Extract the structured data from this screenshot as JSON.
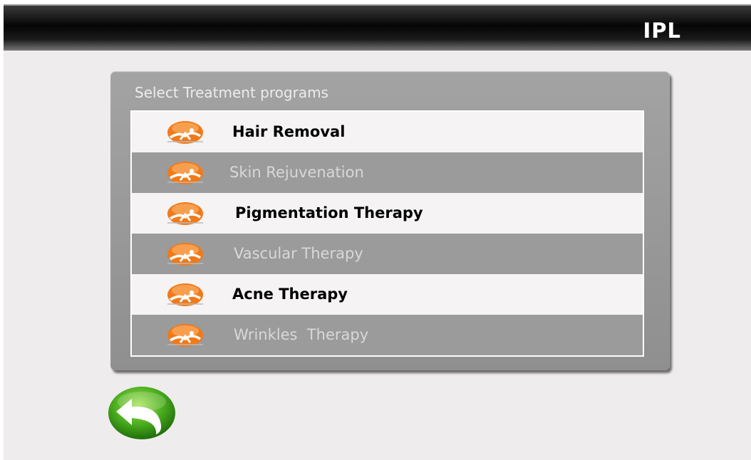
{
  "header": {
    "title": "IPL"
  },
  "panel": {
    "title": "Select Treatment programs"
  },
  "programs": [
    {
      "label": "Hair Removal",
      "icon": "treatment-figure-icon"
    },
    {
      "label": "Skin Rejuvenation",
      "icon": "treatment-figure-icon"
    },
    {
      "label": "Pigmentation Therapy",
      "icon": "treatment-figure-icon"
    },
    {
      "label": "Vascular Therapy",
      "icon": "treatment-figure-icon"
    },
    {
      "label": "Acne Therapy",
      "icon": "treatment-figure-icon"
    },
    {
      "label": "Wrinkles  Therapy",
      "icon": "treatment-figure-icon"
    }
  ],
  "footer": {
    "back_icon": "back-arrow-icon"
  },
  "colors": {
    "accent_orange": "#f07a1a",
    "back_green": "#4caf1f",
    "row_dark": "#9b9b9b",
    "row_light": "#f5f3f3",
    "panel": "#9a9a9a"
  }
}
